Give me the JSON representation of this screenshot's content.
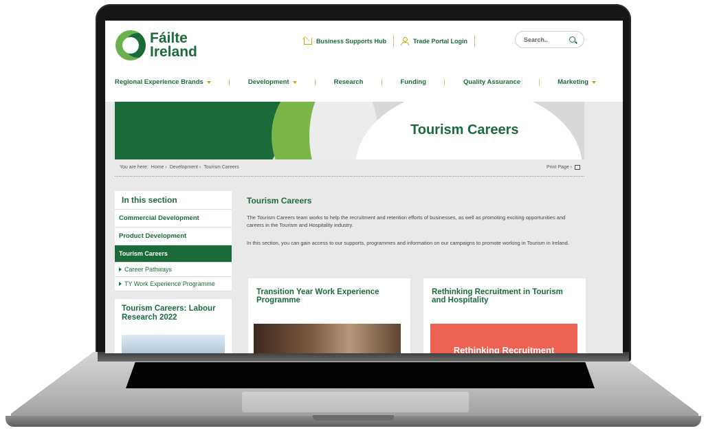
{
  "brand": {
    "line1": "Fáilte",
    "line2": "Ireland",
    "green": "#1b6b3a",
    "lime": "#7ab648",
    "gold": "#c8a400"
  },
  "utility": {
    "business_hub": "Business Supports Hub",
    "trade_portal": "Trade Portal Login",
    "search_placeholder": "Search.."
  },
  "nav": [
    {
      "label": "Regional Experience Brands",
      "dropdown": true
    },
    {
      "label": "Development",
      "dropdown": true
    },
    {
      "label": "Research",
      "dropdown": false
    },
    {
      "label": "Funding",
      "dropdown": false
    },
    {
      "label": "Quality Assurance",
      "dropdown": false
    },
    {
      "label": "Marketing",
      "dropdown": true
    }
  ],
  "banner": {
    "title": "Tourism Careers"
  },
  "breadcrumb": {
    "prefix": "You are here:",
    "items": [
      "Home ›",
      "Development ›",
      "Tourism Careers"
    ]
  },
  "print": {
    "label": "Print Page ›"
  },
  "sidebar": {
    "heading": "In this section",
    "items": [
      "Commercial Development",
      "Product Development",
      "Tourism Careers"
    ],
    "sub_items": [
      "Career Pathways",
      "TY Work Experience Programme"
    ],
    "card_title": "Tourism Careers: Labour Research 2022"
  },
  "main": {
    "title": "Tourism Careers",
    "para1": "The Tourism Careers team works to help the recruitment and retention efforts of businesses, as well as promoting exciting opportunities and careers in the Tourism and Hospitality industry.",
    "para2": "In this section, you can gain access to our supports, programmes and information on our campaigns to promote working in Tourism in Ireland.",
    "cards": [
      {
        "title": "Transition Year Work Experience Programme"
      },
      {
        "title": "Rethinking Recruitment in Tourism and Hospitality",
        "image_text": "Rethinking Recruitment"
      }
    ]
  }
}
